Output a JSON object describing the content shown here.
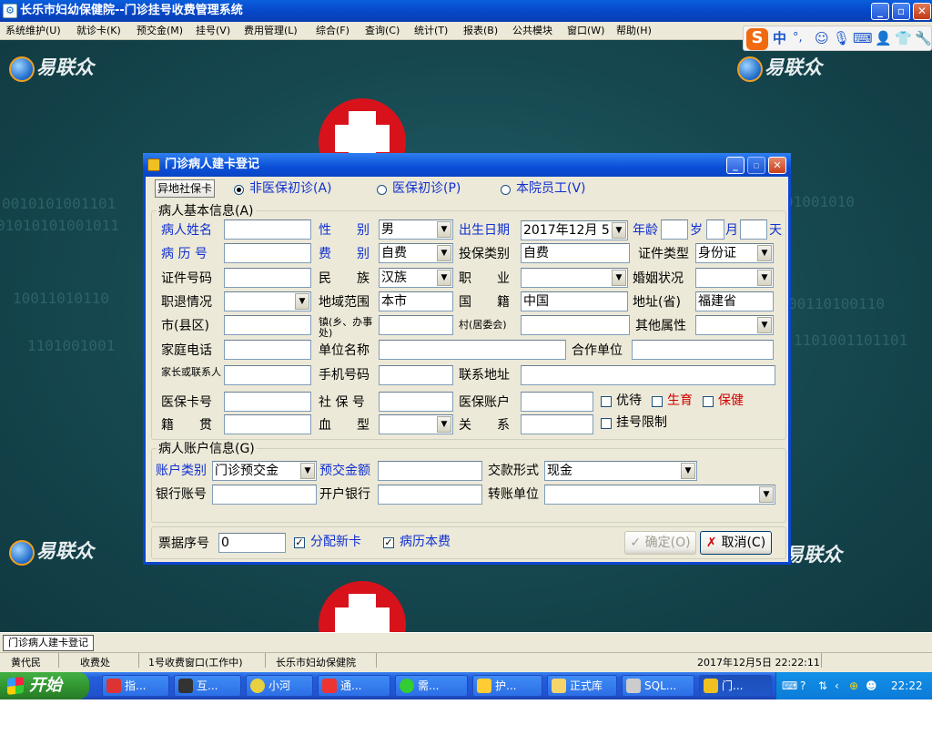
{
  "window": {
    "title": "长乐市妇幼保健院--门诊挂号收费管理系统",
    "minimize": "_",
    "maximize": "▫",
    "close": "✕"
  },
  "menu": [
    "系统维护(U)",
    "就诊卡(K)",
    "预交金(M)",
    "挂号(V)",
    "费用管理(L)",
    "综合(F)",
    "查询(C)",
    "统计(T)",
    "报表(B)",
    "公共模块",
    "窗口(W)",
    "帮助(H)"
  ],
  "ime": {
    "logo": "S",
    "lang": "中",
    "punct": "°,",
    "icons": [
      "smile-icon",
      "mic-icon",
      "keyboard-icon",
      "user-icon",
      "shirt-icon",
      "wrench-icon"
    ]
  },
  "desktop": {
    "logo_text": "易联众",
    "binary_rows": [
      "0010101001101",
      "01010101001011",
      "10011010110",
      "1101001001",
      "01001010",
      "1101001101101",
      "00110100110"
    ]
  },
  "dialog": {
    "title": "门诊病人建卡登记",
    "remote_card_button": "异地社保卡",
    "visit_types": [
      {
        "label": "非医保初诊(A)",
        "selected": true
      },
      {
        "label": "医保初诊(P)",
        "selected": false
      },
      {
        "label": "本院员工(V)",
        "selected": false
      }
    ],
    "basic_group": "病人基本信息(A)",
    "fields": {
      "patient_name": {
        "label": "病人姓名",
        "value": ""
      },
      "gender": {
        "label": "性　　别",
        "value": "男"
      },
      "birth_date": {
        "label": "出生日期",
        "value": "2017年12月 5"
      },
      "age": {
        "label": "年龄",
        "years": "",
        "unit_year": "岁",
        "months": "",
        "unit_month": "月",
        "days": "",
        "unit_day": "天"
      },
      "record_no": {
        "label": "病 历 号",
        "value": ""
      },
      "fee_type": {
        "label": "费　　别",
        "value": "自费"
      },
      "insurance_type": {
        "label": "投保类别",
        "value": "自费"
      },
      "cert_type": {
        "label": "证件类型",
        "value": "身份证"
      },
      "cert_no": {
        "label": "证件号码",
        "value": ""
      },
      "ethnicity": {
        "label": "民　　族",
        "value": "汉族"
      },
      "occupation": {
        "label": "职　　业",
        "value": ""
      },
      "marital": {
        "label": "婚姻状况",
        "value": ""
      },
      "retire": {
        "label": "职退情况",
        "value": ""
      },
      "region": {
        "label": "地域范围",
        "value": "本市"
      },
      "nationality": {
        "label": "国　　籍",
        "value": "中国"
      },
      "province": {
        "label": "地址(省)",
        "value": "福建省"
      },
      "city": {
        "label": "市(县区)",
        "value": ""
      },
      "town": {
        "label": "镇(乡、办事处)",
        "value": ""
      },
      "village": {
        "label": "村(居委会)",
        "value": ""
      },
      "other_attr": {
        "label": "其他属性",
        "value": ""
      },
      "home_phone": {
        "label": "家庭电话",
        "value": ""
      },
      "employer": {
        "label": "单位名称",
        "value": ""
      },
      "coop_unit": {
        "label": "合作单位",
        "value": ""
      },
      "guardian": {
        "label": "家长或联系人",
        "value": ""
      },
      "mobile": {
        "label": "手机号码",
        "value": ""
      },
      "contact_addr": {
        "label": "联系地址",
        "value": ""
      },
      "insurance_card": {
        "label": "医保卡号",
        "value": ""
      },
      "social_no": {
        "label": "社 保 号",
        "value": ""
      },
      "insurance_acct": {
        "label": "医保账户",
        "value": ""
      },
      "native_place": {
        "label": "籍　　贯",
        "value": ""
      },
      "blood_type": {
        "label": "血　　型",
        "value": ""
      },
      "relation": {
        "label": "关　　系",
        "value": ""
      }
    },
    "checks": {
      "preferential": {
        "label": "优待",
        "checked": false
      },
      "fertility": {
        "label": "生育",
        "checked": false
      },
      "healthcare": {
        "label": "保健",
        "checked": false
      },
      "reg_limit": {
        "label": "挂号限制",
        "checked": false
      }
    },
    "account_group": "病人账户信息(G)",
    "account": {
      "acct_type": {
        "label": "账户类别",
        "value": "门诊预交金"
      },
      "prepay": {
        "label": "预交金额",
        "value": ""
      },
      "pay_method": {
        "label": "交款形式",
        "value": "现金"
      },
      "bank_acct": {
        "label": "银行账号",
        "value": ""
      },
      "bank": {
        "label": "开户银行",
        "value": ""
      },
      "transfer_unit": {
        "label": "转账单位",
        "value": ""
      }
    },
    "footer": {
      "receipt_label": "票据序号",
      "receipt_value": "0",
      "assign_card": {
        "label": "分配新卡",
        "checked": true
      },
      "record_fee": {
        "label": "病历本费",
        "checked": true
      },
      "ok": "确定(O)",
      "cancel": "取消(C)"
    }
  },
  "mdi_tab": "门诊病人建卡登记",
  "status": {
    "user": "黄代民",
    "dept": "收费处",
    "window": "1号收费窗口(工作中)",
    "hospital": "长乐市妇幼保健院",
    "datetime": "2017年12月5日 22:22:11"
  },
  "taskbar": {
    "start": "开始",
    "tasks": [
      "指...",
      "互...",
      "小河",
      "通...",
      "需...",
      "护...",
      "正式库",
      "SQL...",
      "门..."
    ],
    "time": "22:22"
  },
  "colors": {
    "accent": "#0a46d0",
    "desktop": "#16474f",
    "label_blue": "#1030d0",
    "label_red": "#d00000"
  }
}
